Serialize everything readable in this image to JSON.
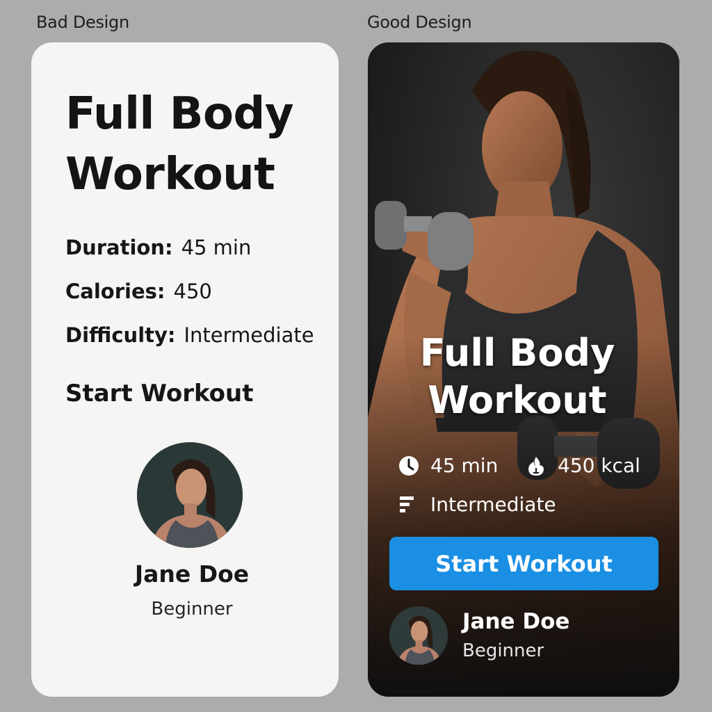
{
  "labels": {
    "bad": "Bad Design",
    "good": "Good Design"
  },
  "bad_design": {
    "title": "Full Body Workout",
    "duration": {
      "key": "Duration:",
      "value": "45 min"
    },
    "calories": {
      "key": "Calories:",
      "value": "450"
    },
    "difficulty": {
      "key": "Difficulty:",
      "value": "Intermediate"
    },
    "start_label": "Start Workout",
    "user": {
      "name": "Jane Doe",
      "level": "Beginner"
    },
    "colors": {
      "card": "#f5f5f3",
      "text": "#141414"
    }
  },
  "good_design": {
    "title": "Full Body Workout",
    "duration": {
      "icon": "clock-icon",
      "value": "45 min"
    },
    "calories": {
      "icon": "flame-icon",
      "value": "450 kcal"
    },
    "difficulty": {
      "icon": "difficulty-bars-icon",
      "value": "Intermediate"
    },
    "start_label": "Start Workout",
    "user": {
      "name": "Jane Doe",
      "level": "Beginner"
    },
    "colors": {
      "card": "#161616",
      "button": "#1a8fe3",
      "text": "#ffffff"
    }
  }
}
